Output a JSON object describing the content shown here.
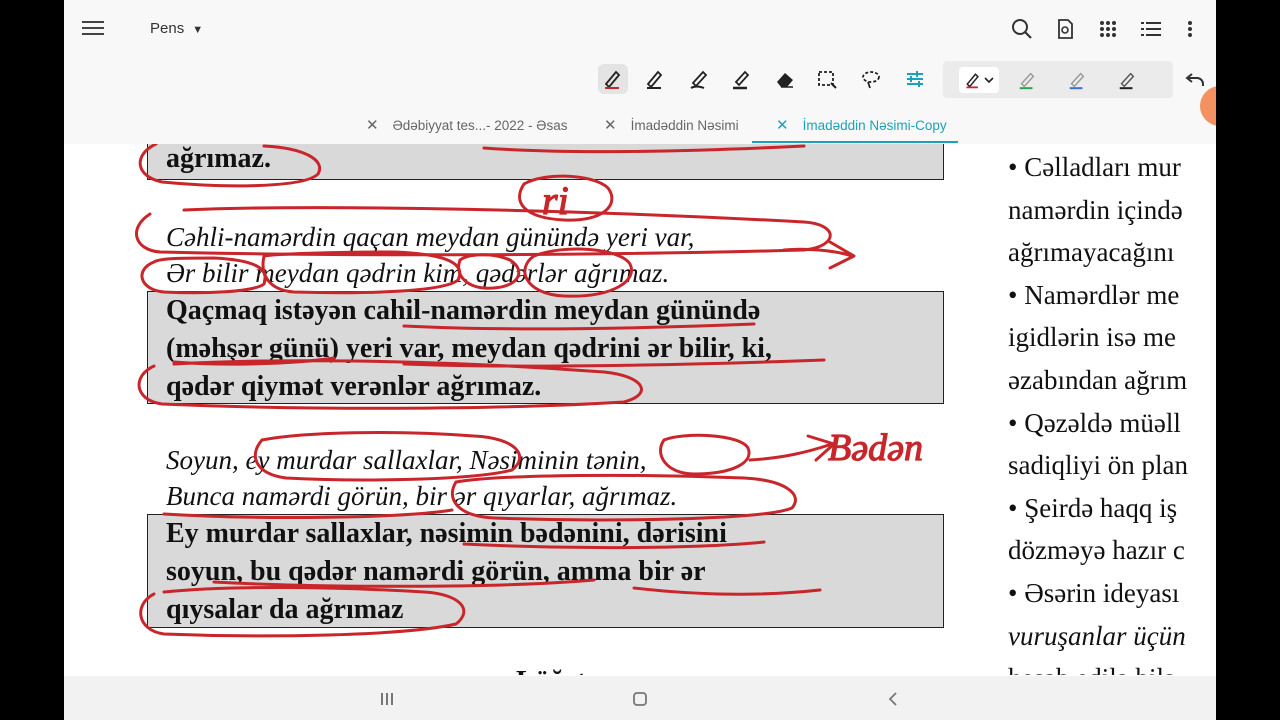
{
  "app": {
    "mode_label": "Pens"
  },
  "tabs": [
    {
      "label": "Ədəbiyyat tes...- 2022 - Əsas",
      "active": false
    },
    {
      "label": "İmadəddin Nəsimi",
      "active": false
    },
    {
      "label": "İmadəddin Nəsimi-Copy",
      "active": true
    }
  ],
  "colors": {
    "accent": "#1aa3b8",
    "ink": "#c8262b",
    "box": "#d9d9d9"
  },
  "icons": [
    "menu-icon",
    "search-icon",
    "page-search-icon",
    "grid-icon",
    "list-icon",
    "more-icon",
    "pen-icon",
    "highlighter-icon",
    "eraser-icon",
    "lasso-icon",
    "shape-icon",
    "settings-sliders-icon",
    "undo-icon"
  ],
  "doc": {
    "box0": [
      "ağrımaz."
    ],
    "poem1": [
      "Cəhli-namərdin qaçan meydan günündə yeri var,",
      "Ər bilir meydan qədrin kim, qədərlər ağrımaz."
    ],
    "box1": [
      "Qaçmaq istəyən cahil-namərdin meydan günündə",
      "(məhşər günü) yeri var, meydan qədrini ər bilir, ki,",
      "qədər qiymət verənlər ağrımaz."
    ],
    "poem2": [
      "Soyun, ey murdar sallaxlar, Nəsiminin tənin,",
      "Bunca namərdi görün, bir ər qıyarlar, ağrımaz."
    ],
    "box2": [
      "Ey murdar sallaxlar, nəsimin bədənini, dərisini",
      "soyun, bu qədər namərdi görün, amma bir ər",
      "qıysalar da ağrımaz"
    ],
    "heading_partial": "Lüğət",
    "right_lines": [
      "• Cəlladları mur",
      "namərdin içində",
      "ağrımayacağını",
      "• Namərdlər me",
      "igidlərin isə me",
      "əzabından ağrım",
      "• Qəzəldə müəll",
      "sadiqliyi ön plan",
      "• Şeirdə haqq iş",
      "dözməyə hazır c",
      "• Əsərin ideyası",
      "vuruşanlar üçün",
      "hesab edilə bilə"
    ]
  },
  "annotations": {
    "ri": "ri",
    "bədən": "Bədən"
  }
}
